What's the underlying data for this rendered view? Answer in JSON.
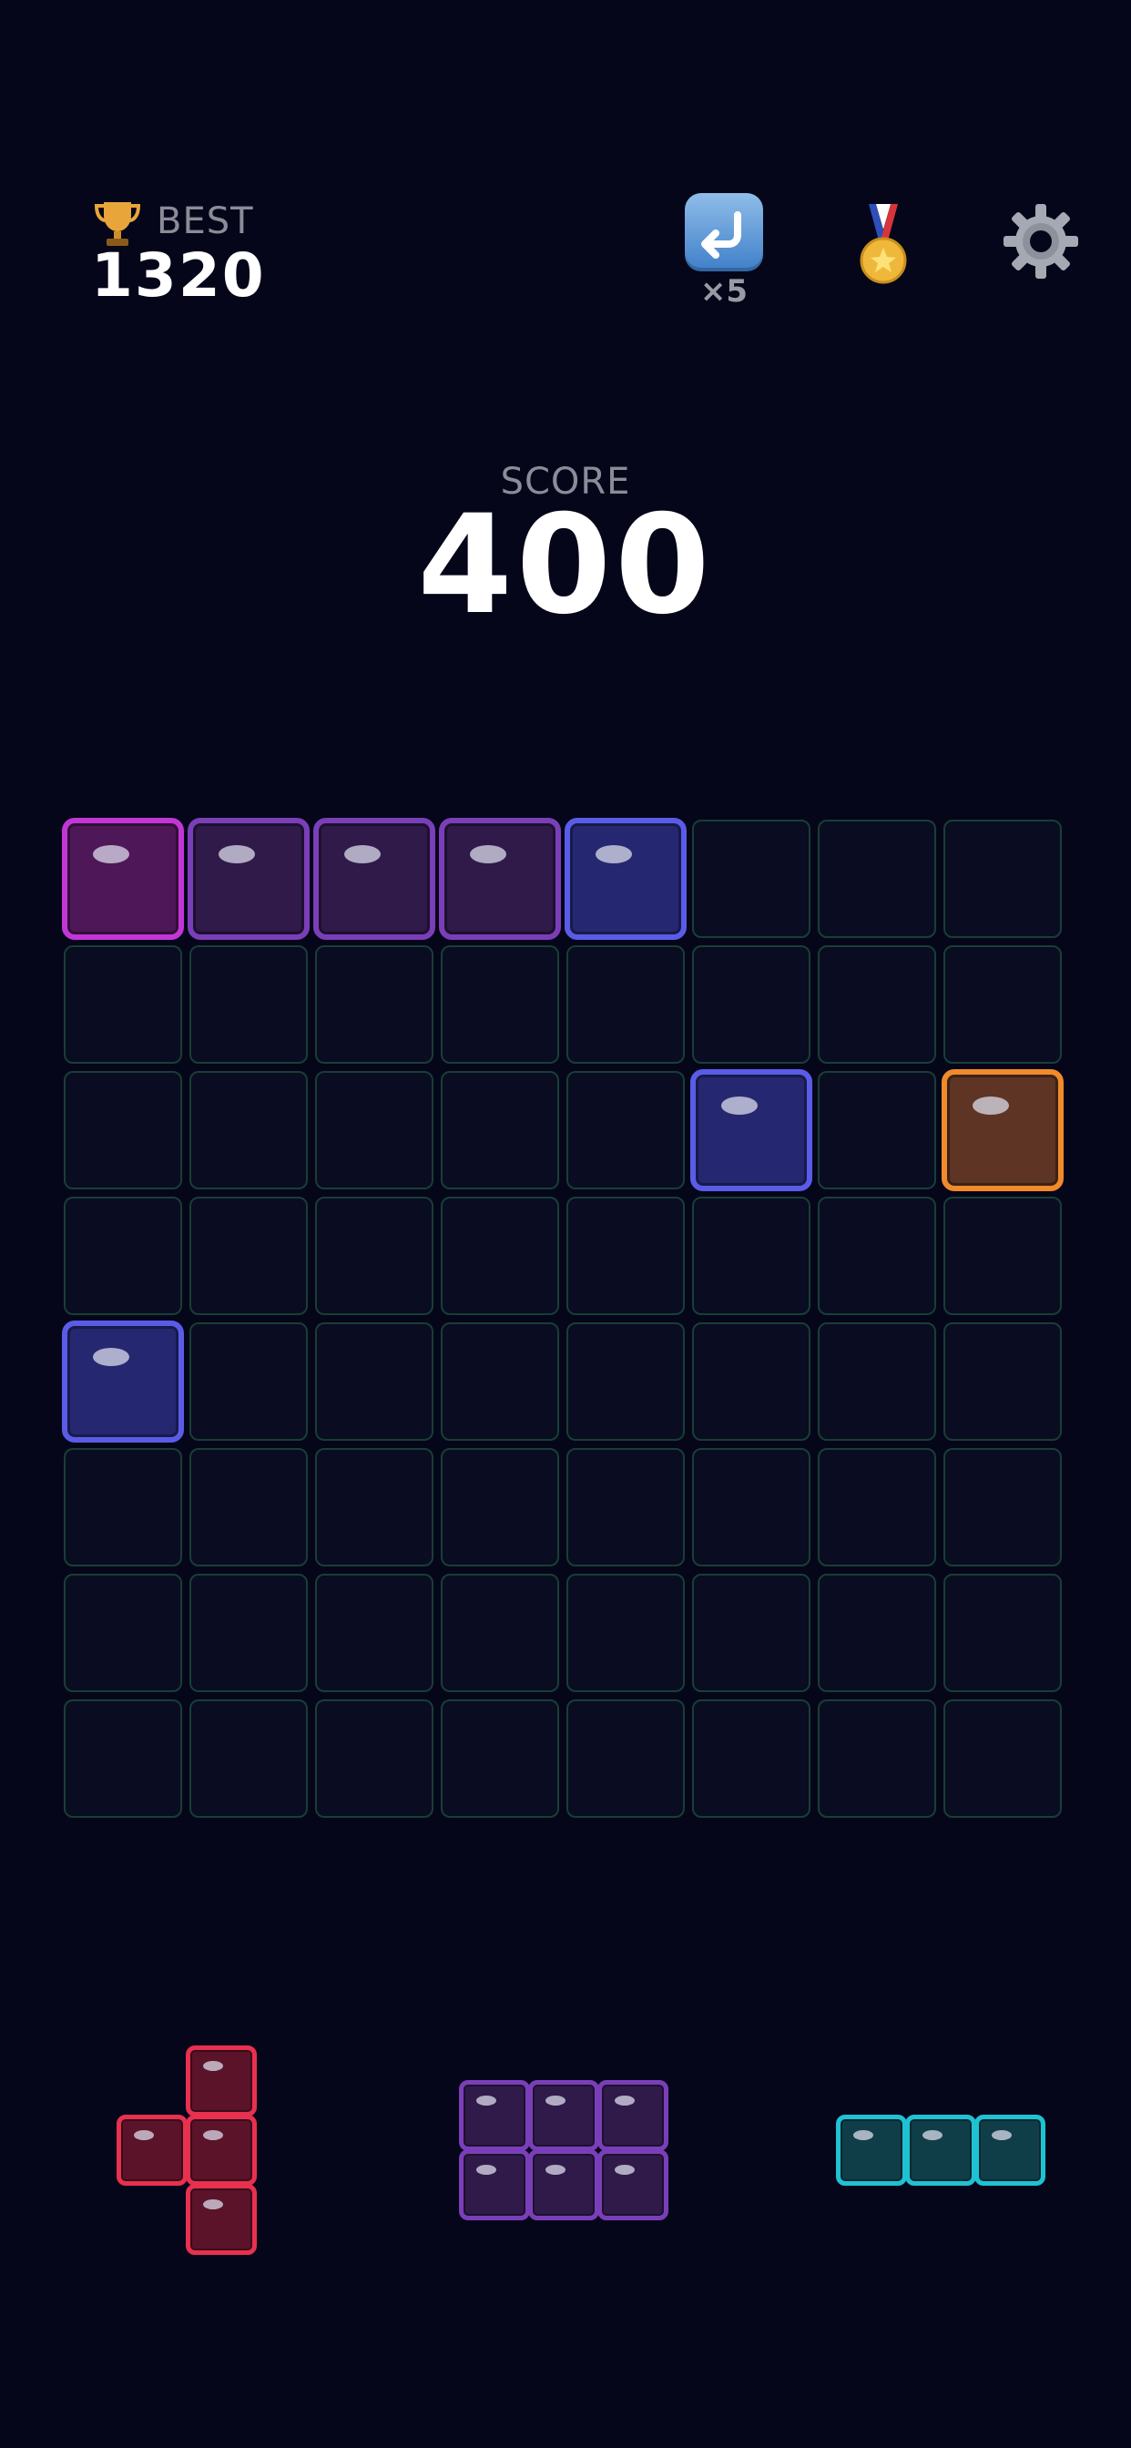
{
  "header": {
    "best_label": "BEST",
    "best_value": "1320",
    "undo_count": "×5",
    "icons": [
      "trophy-icon",
      "undo-icon",
      "medal-icon",
      "gear-icon"
    ]
  },
  "score": {
    "label": "SCORE",
    "value": "400"
  },
  "board": {
    "rows": 8,
    "cols": 8,
    "filled": [
      {
        "row": 0,
        "col": 0,
        "color": "magenta"
      },
      {
        "row": 0,
        "col": 1,
        "color": "purple"
      },
      {
        "row": 0,
        "col": 2,
        "color": "purple"
      },
      {
        "row": 0,
        "col": 3,
        "color": "purple"
      },
      {
        "row": 0,
        "col": 4,
        "color": "indigo"
      },
      {
        "row": 2,
        "col": 5,
        "color": "indigo"
      },
      {
        "row": 2,
        "col": 7,
        "color": "orange"
      },
      {
        "row": 4,
        "col": 0,
        "color": "indigo"
      }
    ]
  },
  "tray": [
    {
      "name": "red-t-piece",
      "color": "red",
      "cells": [
        [
          0,
          1
        ],
        [
          1,
          0
        ],
        [
          1,
          1
        ],
        [
          2,
          1
        ]
      ]
    },
    {
      "name": "purple-rect-piece",
      "color": "purple",
      "cells": [
        [
          0,
          0
        ],
        [
          0,
          1
        ],
        [
          0,
          2
        ],
        [
          1,
          0
        ],
        [
          1,
          1
        ],
        [
          1,
          2
        ]
      ]
    },
    {
      "name": "cyan-line-piece",
      "color": "cyan",
      "cells": [
        [
          0,
          0
        ],
        [
          0,
          1
        ],
        [
          0,
          2
        ]
      ]
    }
  ],
  "palette": {
    "magenta": {
      "border": "#c236d6",
      "fill": "#4e1757"
    },
    "purple": {
      "border": "#7a3fb8",
      "fill": "#2f1a4a"
    },
    "indigo": {
      "border": "#5a5ce8",
      "fill": "#252870"
    },
    "orange": {
      "border": "#f08a2a",
      "fill": "#5e3424"
    },
    "red": {
      "border": "#e8304f",
      "fill": "#5a1328"
    },
    "cyan": {
      "border": "#1fc2d3",
      "fill": "#0f3e48"
    },
    "background": "#06061a",
    "grid_border": "#173f35"
  }
}
